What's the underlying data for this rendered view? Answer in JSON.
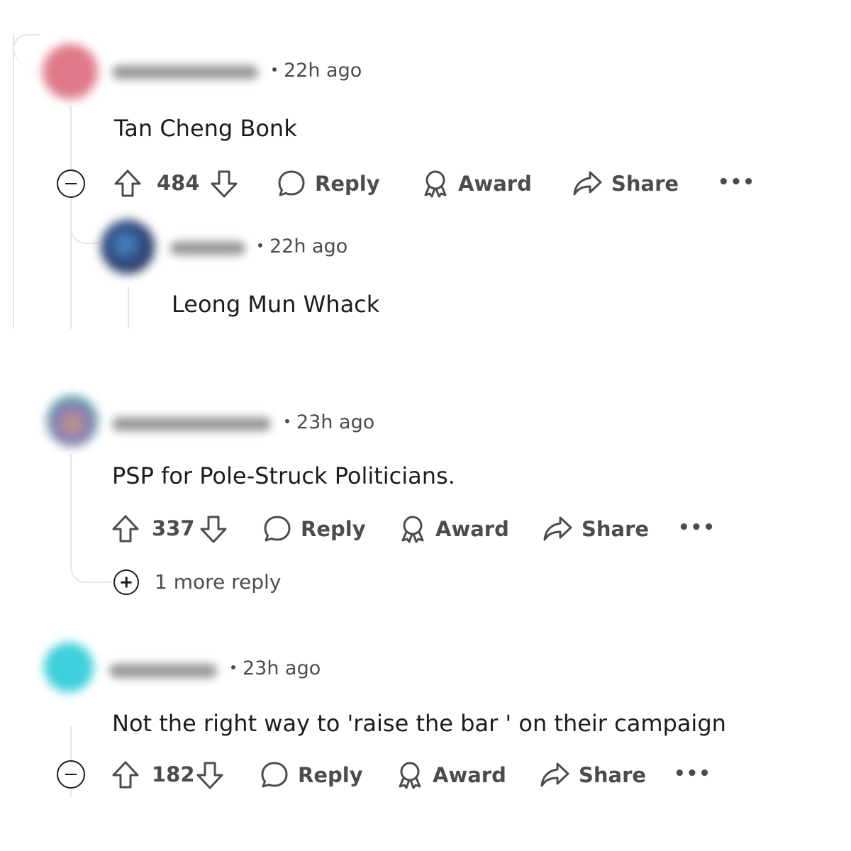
{
  "comments": [
    {
      "time": "22h ago",
      "body": "Tan Cheng Bonk",
      "votes": "484",
      "actions": {
        "reply": "Reply",
        "award": "Award",
        "share": "Share",
        "more": "•••"
      },
      "reply": {
        "time": "22h ago",
        "body": "Leong Mun Whack"
      }
    },
    {
      "time": "23h ago",
      "body": "PSP for Pole-Struck Politicians.",
      "votes": "337",
      "actions": {
        "reply": "Reply",
        "award": "Award",
        "share": "Share",
        "more": "•••"
      },
      "more_replies": "1 more reply"
    },
    {
      "time": "23h ago",
      "body": "Not the right way to 'raise the bar ' on their campaign",
      "votes": "182",
      "actions": {
        "reply": "Reply",
        "award": "Award",
        "share": "Share",
        "more": "•••"
      }
    }
  ],
  "colors": {
    "avatar1": "#e07a8a",
    "avatar2_outer": "#2a3e6e",
    "avatar2_inner": "#4a8fd0",
    "avatar3_outer": "#4a9ea0",
    "avatar3_inner": "#9a7bb8",
    "avatar4": "#3fd0dc",
    "text": "#1c1c1c",
    "muted": "#4a4d50",
    "thread": "#e4e6e8"
  }
}
